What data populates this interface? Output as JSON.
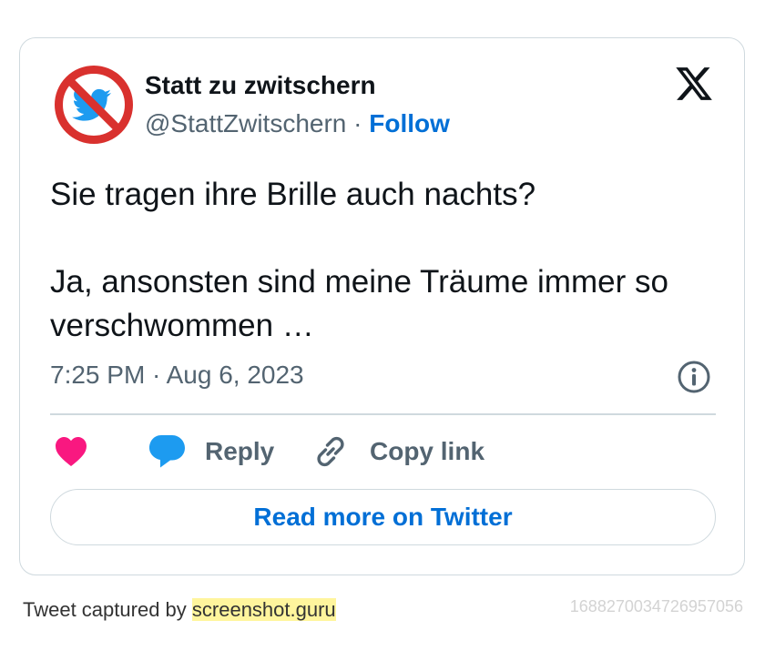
{
  "tweet": {
    "author_name": "Statt zu zwitschern",
    "handle": "@StattZwitschern",
    "separator": " · ",
    "follow_label": "Follow",
    "text_line1": "Sie tragen ihre Brille auch nachts?",
    "text_line2": "Ja, ansonsten sind meine Träume immer so verschwommen …",
    "timestamp": "7:25 PM · Aug 6, 2023",
    "reply_label": "Reply",
    "copy_link_label": "Copy link",
    "read_more_label": "Read more on Twitter"
  },
  "icons": {
    "avatar": "no-twitter-bird-avatar",
    "logo": "x-logo-icon",
    "info": "info-icon",
    "like": "heart-icon",
    "reply": "speech-bubble-icon",
    "copy": "link-icon"
  },
  "colors": {
    "accent": "#006fd6",
    "heart": "#f91880",
    "reply_bubble": "#1d9bf0",
    "muted_text": "#536471",
    "border": "#cfd9de",
    "highlight": "#fff59d"
  },
  "footer": {
    "captured_by": "Tweet captured by ",
    "link_text": "screenshot.guru",
    "tweet_id": "1688270034726957056"
  }
}
